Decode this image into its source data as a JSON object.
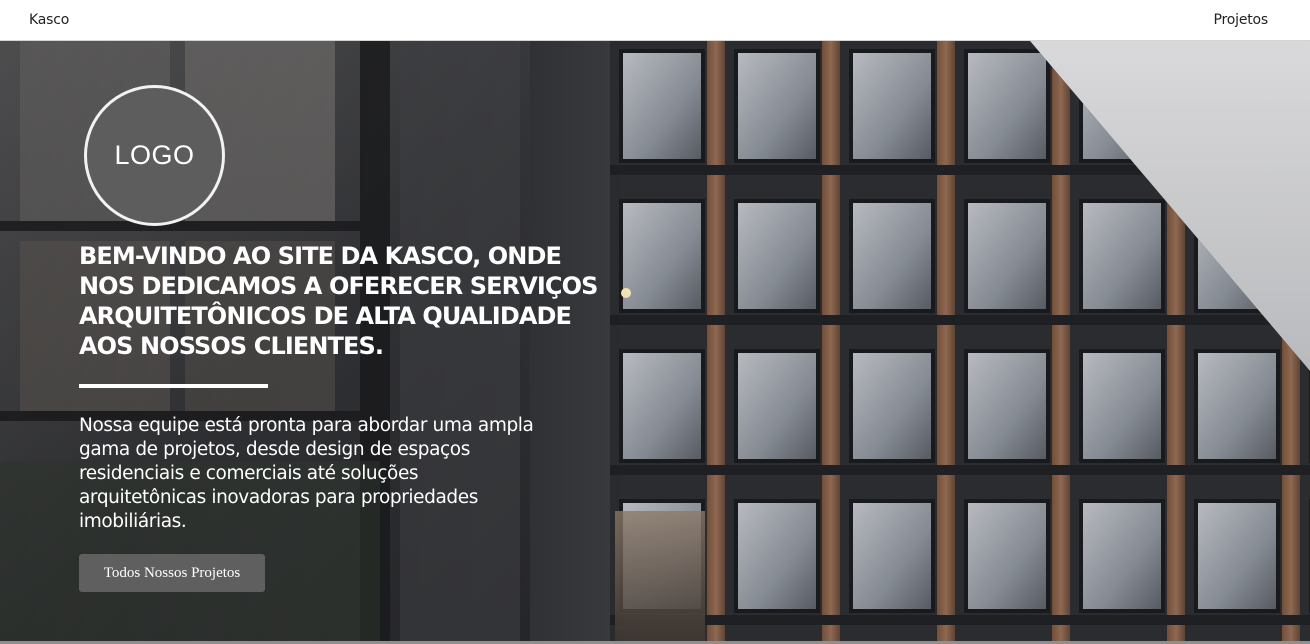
{
  "navbar": {
    "brand": "Kasco",
    "link_projects": "Projetos"
  },
  "hero": {
    "logo_text": "LOGO",
    "headline": "BEM-VINDO AO SITE DA KASCO, ONDE NOS DEDICAMOS A OFERECER SERVIÇOS ARQUITETÔNICOS DE ALTA QUALIDADE AOS NOSSOS CLIENTES.",
    "lead": "Nossa equipe está pronta para abordar uma ampla gama de projetos, desde design de espaços residenciais e comerciais até soluções arquitetônicas inovadoras para propriedades imobiliárias.",
    "cta_label": "Todos Nossos Projetos",
    "background_image": "building-facade-photo"
  },
  "colors": {
    "navbar_bg": "#ffffff",
    "text_light": "#ffffff",
    "logo_bg": "#5d5d5d",
    "button_bg": "#5f5f5f"
  }
}
